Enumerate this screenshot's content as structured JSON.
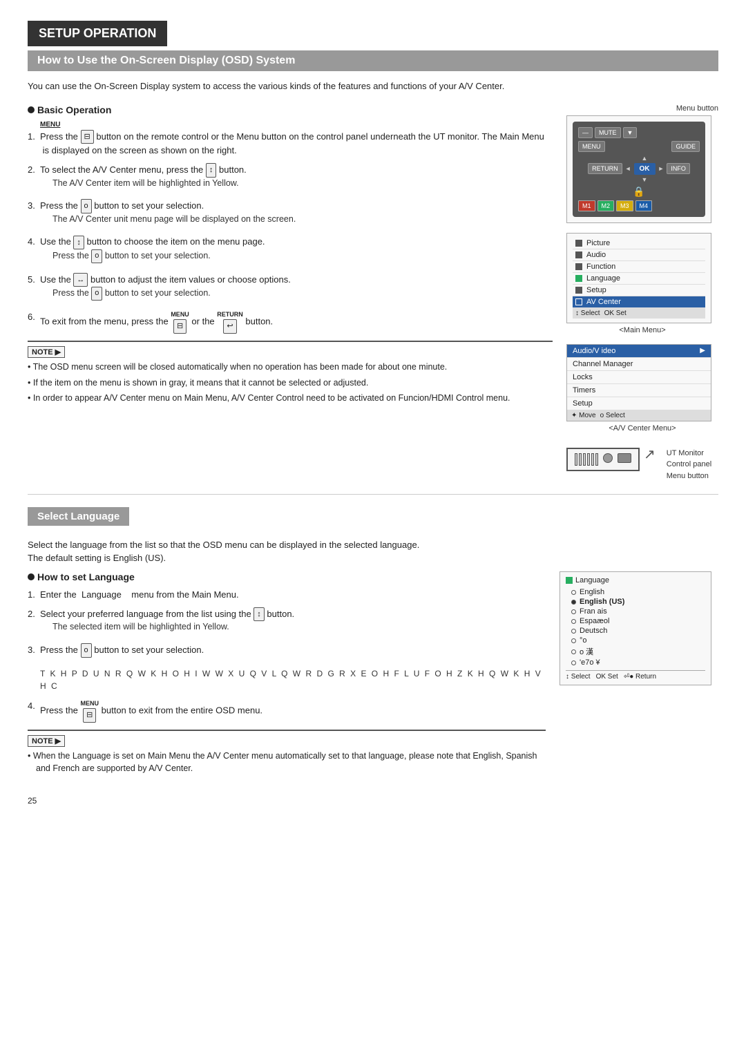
{
  "page": {
    "title": "SETUP OPERATION",
    "subtitle": "How to Use the On-Screen Display (OSD) System",
    "page_number": "25"
  },
  "intro": {
    "text": "You can use the On-Screen Display system to access the various kinds of the features and functions of your A/V Center."
  },
  "basic_operation": {
    "heading": "Basic Operation",
    "steps": [
      {
        "num": "1.",
        "text": "Press the",
        "button": "MENU",
        "text2": "button on the remote control or the Menu button on the control panel underneath the UT monitor. The Main Menu  is displayed on the screen as shown on the right."
      },
      {
        "num": "2.",
        "text": "To select the A/V Center menu, press the",
        "button": "↕",
        "text2": "button.",
        "sub": "The A/V Center item will be highlighted in Yellow."
      },
      {
        "num": "3.",
        "text": "Press the",
        "button": "o",
        "text2": "button to set your selection.",
        "sub": "The A/V Center unit menu page will be displayed on the screen."
      },
      {
        "num": "4.",
        "text": "Use the",
        "button": "↕",
        "text2": "button to choose the item on the menu page.",
        "sub2": "Press the",
        "button2": "o",
        "text3": "button to set your selection."
      },
      {
        "num": "5.",
        "text": "Use the",
        "button": "↔",
        "text2": "button to adjust the item values or choose options.",
        "sub2": "Press the",
        "button2": "o",
        "text3": "button to set your selection."
      },
      {
        "num": "6.",
        "text": "To exit from the menu, press the",
        "button": "MENU",
        "text2": "or the",
        "button3": "RETURN",
        "text3": "button."
      }
    ],
    "notes": [
      "The OSD menu screen will be closed automatically when no operation has been made for about one minute.",
      "If the item on the menu is shown in gray, it means that it cannot be selected or adjusted.",
      "In order to appear A/V Center menu on Main Menu, A/V Center Control need to be activated on Funcion/HDMI Control menu."
    ]
  },
  "remote_diagram": {
    "menu_button_label": "Menu button",
    "buttons": {
      "mute": "MUTE",
      "menu": "MENU",
      "guide": "GUIDE",
      "return": "RETURN",
      "ok": "OK",
      "info": "INFO",
      "m1": "M1",
      "m2": "M2",
      "m3": "M3",
      "m4": "M4"
    }
  },
  "main_menu_diagram": {
    "label": "<Main Menu>",
    "items": [
      {
        "icon": "picture",
        "label": "Picture"
      },
      {
        "icon": "audio",
        "label": "Audio"
      },
      {
        "icon": "function",
        "label": "Function"
      },
      {
        "icon": "language",
        "label": "Language"
      },
      {
        "icon": "setup",
        "label": "Setup"
      },
      {
        "icon": "av_center",
        "label": "AV Center",
        "active": true
      }
    ],
    "bottom": "↕ Select  OK Set"
  },
  "av_center_menu": {
    "label": "<A/V Center Menu>",
    "items": [
      {
        "label": "Audio/Video",
        "arrow": "▶",
        "active": true
      },
      {
        "label": "Channel Manager"
      },
      {
        "label": "Locks"
      },
      {
        "label": "Timers"
      },
      {
        "label": "Setup"
      }
    ],
    "bottom": "✦ Move  o Select"
  },
  "ut_monitor": {
    "label": "UT Monitor\nControl panel\nMenu button"
  },
  "select_language": {
    "heading": "Select Language",
    "description_line1": "Select the language from the list so that the OSD menu can be displayed in the selected language.",
    "description_line2": "The default setting is English (US).",
    "how_to_heading": "How to set Language",
    "steps": [
      {
        "num": "1.",
        "text": "Enter the  Language    menu from the Main Menu."
      },
      {
        "num": "2.",
        "text": "Select your preferred language from the list using the",
        "button": "↕",
        "text2": "button.",
        "sub": "The selected item will be highlighted in Yellow."
      },
      {
        "num": "3.",
        "text": "Press the",
        "button": "o",
        "text2": "button to set your selection."
      },
      {
        "num": "4.",
        "text_label": "MENU",
        "text": "Press the",
        "button": "MENU",
        "text2": "button to exit from the entire OSD menu."
      }
    ],
    "scrambled": "T K H  P D U N  R Q  W K H  O H I W  W X U Q V  L Q W R  D  G R X E O H  F L U F O H  Z K H Q  W K H  V H C",
    "notes": [
      "When the Language is set on Main Menu the A/V Center menu automatically set to that language, please note that English, Spanish and French are supported by A/V Center."
    ]
  },
  "language_menu_diagram": {
    "title": "Language",
    "items": [
      {
        "label": "English",
        "selected": false
      },
      {
        "label": "English (US)",
        "selected": true
      },
      {
        "label": "Fran ais",
        "selected": false
      },
      {
        "label": "Español",
        "selected": false
      },
      {
        "label": "Deutsch",
        "selected": false
      },
      {
        "label": "°o",
        "selected": false
      },
      {
        "label": "o 漢",
        "selected": false
      },
      {
        "label": "'e7o ¥",
        "selected": false
      }
    ],
    "bottom": "↕ Select  OK Set  ⏎ Return"
  }
}
